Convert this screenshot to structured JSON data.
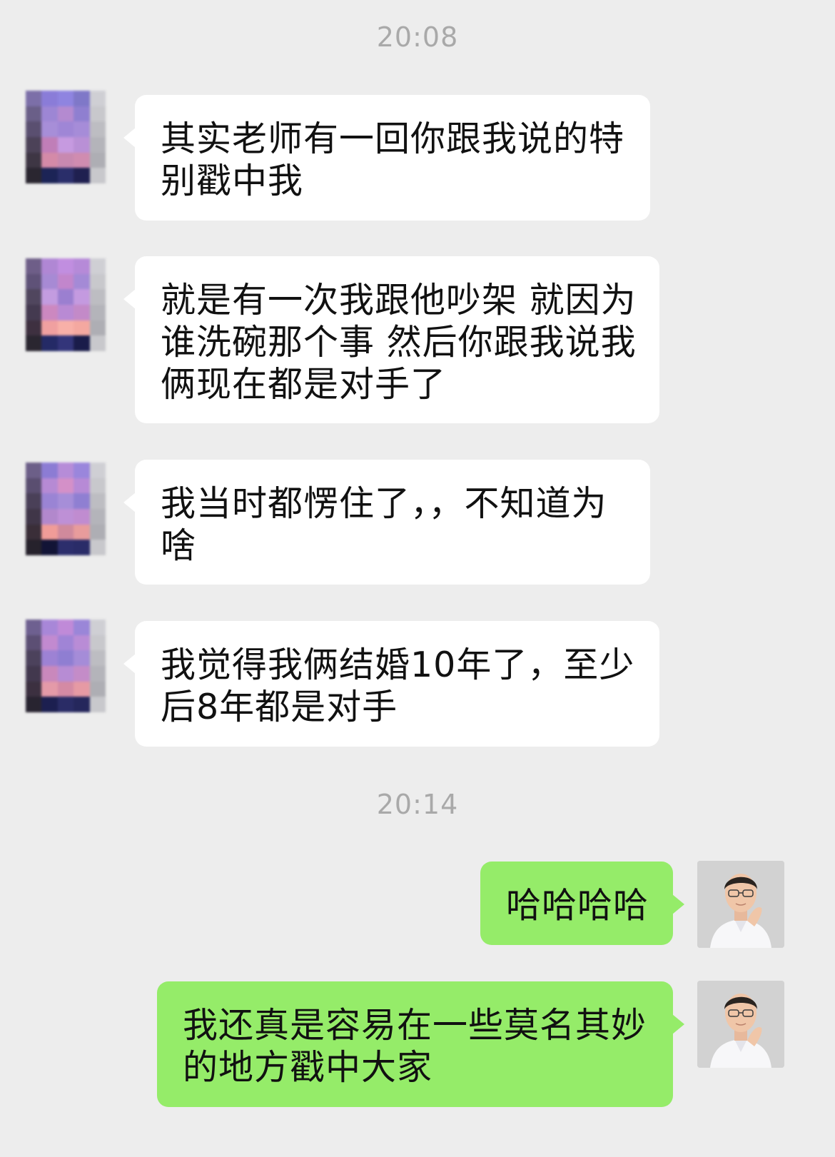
{
  "chat": {
    "timestamps": [
      "20:08",
      "20:14"
    ],
    "messages": [
      {
        "side": "in",
        "text": "其实老师有一回你跟我说的特别戳中我"
      },
      {
        "side": "in",
        "text": "就是有一次我跟他吵架 就因为谁洗碗那个事 然后你跟我说我俩现在都是对手了"
      },
      {
        "side": "in",
        "text": "我当时都愣住了，，不知道为啥"
      },
      {
        "side": "in",
        "text": "我觉得我俩结婚10年了，至少后8年都是对手"
      },
      {
        "side": "out",
        "text": "哈哈哈哈"
      },
      {
        "side": "out",
        "text": "我还真是容易在一些莫名其妙的地方戳中大家"
      }
    ]
  },
  "colors": {
    "background": "#ededed",
    "incoming_bubble": "#ffffff",
    "outgoing_bubble": "#95ec69",
    "timestamp": "#a9a9a9"
  },
  "icons": {
    "contact_avatar": "pixelated-avatar",
    "user_avatar": "person-photo-avatar"
  }
}
